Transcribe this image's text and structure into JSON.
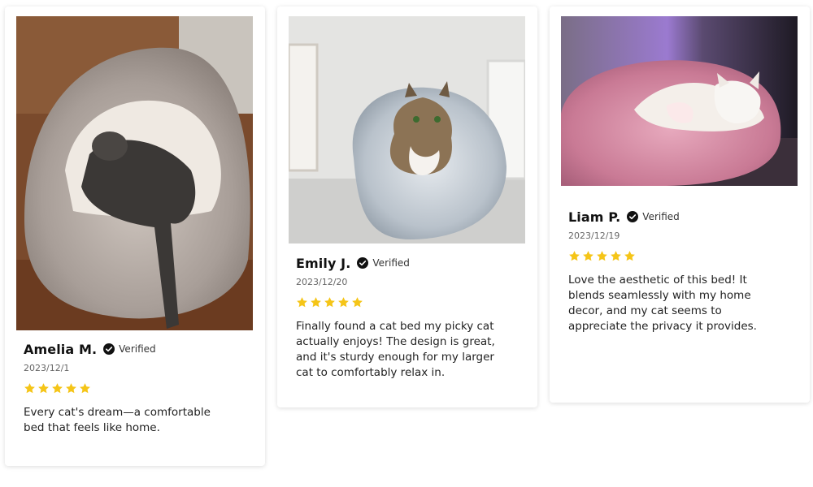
{
  "colors": {
    "star": "#f5c518",
    "card_bg": "#ffffff",
    "text": "#222222"
  },
  "reviews": [
    {
      "name": "Amelia M.",
      "verified_label": "Verified",
      "date": "2023/12/1",
      "rating": 5,
      "text": "Every cat's dream—a comfortable bed that feels like home.",
      "photo_icon": "photo-gray-fluffy-cave-bed-tabby-cat"
    },
    {
      "name": "Emily J.",
      "verified_label": "Verified",
      "date": "2023/12/20",
      "rating": 5,
      "text": "Finally found a cat bed my picky cat actually enjoys! The design is great, and it's sturdy enough for my larger cat to comfortably relax in.",
      "photo_icon": "photo-light-gray-fluffy-bed-tabby-cat"
    },
    {
      "name": "Liam P.",
      "verified_label": "Verified",
      "date": "2023/12/19",
      "rating": 5,
      "text": "Love the aesthetic of this bed! It blends seamlessly with my home decor, and my cat seems to appreciate the privacy it provides.",
      "photo_icon": "photo-pink-fluffy-bed-white-cat"
    }
  ]
}
